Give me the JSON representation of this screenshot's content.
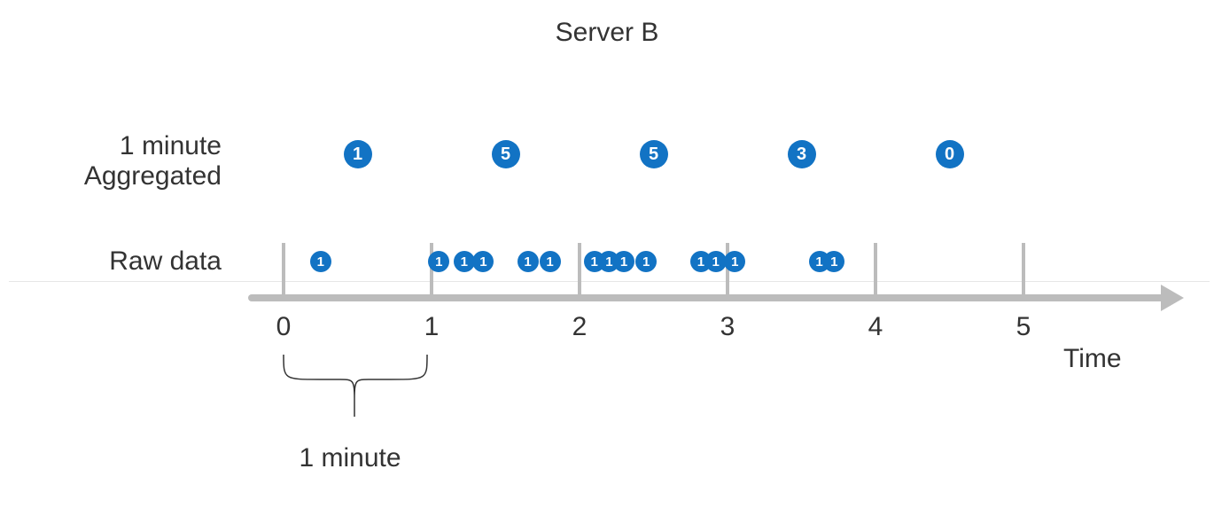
{
  "title": "Server B",
  "labels": {
    "aggregated_l1": "1 minute",
    "aggregated_l2": "Aggregated",
    "raw": "Raw data",
    "xlabel": "Time",
    "brace_caption": "1 minute"
  },
  "chart_data": {
    "type": "timeline",
    "axis": {
      "start": 0,
      "end": 5,
      "ticks": [
        0,
        1,
        2,
        3,
        4,
        5
      ],
      "unit": "minute"
    },
    "aggregated": [
      {
        "bucket_start": 0,
        "count": 1,
        "center_t": 0.5
      },
      {
        "bucket_start": 1,
        "count": 5,
        "center_t": 1.5
      },
      {
        "bucket_start": 2,
        "count": 5,
        "center_t": 2.5
      },
      {
        "bucket_start": 3,
        "count": 3,
        "center_t": 3.5
      },
      {
        "bucket_start": 4,
        "count": 0,
        "center_t": 4.5
      }
    ],
    "raw": [
      {
        "t": 0.25,
        "v": 1
      },
      {
        "t": 1.05,
        "v": 1
      },
      {
        "t": 1.22,
        "v": 1
      },
      {
        "t": 1.35,
        "v": 1
      },
      {
        "t": 1.65,
        "v": 1
      },
      {
        "t": 1.8,
        "v": 1
      },
      {
        "t": 2.1,
        "v": 1
      },
      {
        "t": 2.2,
        "v": 1
      },
      {
        "t": 2.3,
        "v": 1
      },
      {
        "t": 2.45,
        "v": 1
      },
      {
        "t": 2.82,
        "v": 1
      },
      {
        "t": 2.92,
        "v": 1
      },
      {
        "t": 3.05,
        "v": 1
      },
      {
        "t": 3.62,
        "v": 1
      },
      {
        "t": 3.72,
        "v": 1
      }
    ],
    "brace": {
      "from": 0,
      "to": 1
    },
    "accent_color": "#1273c4"
  }
}
